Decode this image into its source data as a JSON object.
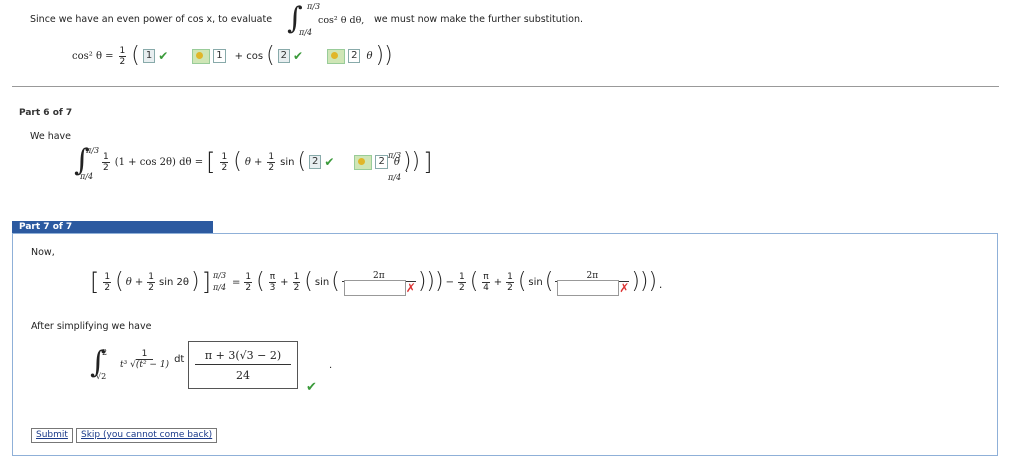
{
  "intro": {
    "text": "Since we have an even power of cos x, to evaluate",
    "int_upper": "π/3",
    "int_lower": "π/4",
    "integrand": "cos² θ dθ,",
    "tail": "we must now make the further substitution."
  },
  "substitution": {
    "lhs": "cos² θ =",
    "half_num": "1",
    "half_den": "2",
    "box1": "1",
    "box1_mark": "1",
    "plus_cos": "+ cos",
    "box2": "2",
    "box2_mark": "2",
    "theta": "θ"
  },
  "part6": {
    "header": "Part 6 of 7",
    "we_have": "We have",
    "int_upper": "π/3",
    "int_lower": "π/4",
    "integrand": "(1 + cos 2θ) dθ =",
    "half_num": "1",
    "half_den": "2",
    "theta_plus": "θ +",
    "sin": "sin",
    "box": "2",
    "box_mark": "2",
    "theta": "θ",
    "eval_upper": "π/3",
    "eval_lower": "π/4",
    "period": "."
  },
  "part7": {
    "header": "Part 7 of 7",
    "now": "Now,",
    "expr_lhs": "θ + ",
    "sin2theta": "sin 2θ",
    "eval_upper": "π/3",
    "eval_lower": "π/4",
    "equals": "=",
    "pi": "π",
    "three": "3",
    "four": "4",
    "sin": "sin",
    "two_pi": "2π",
    "minus": "−",
    "plus": "+",
    "after": "After simplifying we have",
    "int2_upper": "2",
    "int2_lower": "√2",
    "int2_num": "1",
    "int2_den": "t³ √(t² − 1)",
    "dt": "dt =",
    "answer_num": "π + 3(√3 − 2)",
    "answer_den": "24",
    "period": "."
  },
  "buttons": {
    "submit": "Submit",
    "skip": "Skip (you cannot come back)"
  }
}
